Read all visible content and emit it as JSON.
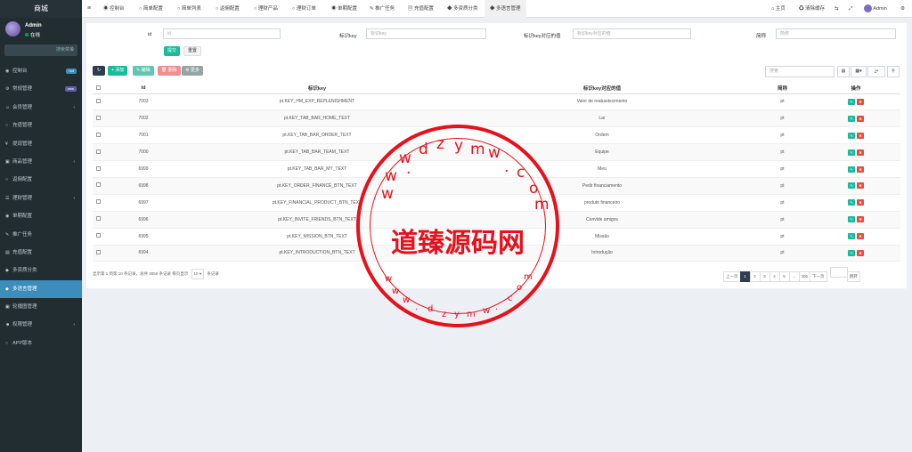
{
  "sidebar": {
    "logo": "商城",
    "user_name": "Admin",
    "user_status": "在线",
    "search_placeholder": "搜索菜单",
    "items": [
      {
        "label": "控制台",
        "badge": "hot"
      },
      {
        "label": "常规管理",
        "badge": "new"
      },
      {
        "label": "会员管理"
      },
      {
        "label": "充值管理"
      },
      {
        "label": "提现管理"
      },
      {
        "label": "商品管理"
      },
      {
        "label": "返佣配置"
      },
      {
        "label": "理财管理"
      },
      {
        "label": "单期配置"
      },
      {
        "label": "推广任务"
      },
      {
        "label": "充值配置"
      },
      {
        "label": "多资质分类"
      },
      {
        "label": "多语言管理"
      },
      {
        "label": "轮播图管理"
      },
      {
        "label": "权限管理"
      },
      {
        "label": "APP版本"
      }
    ]
  },
  "topbar": {
    "tabs": [
      "控制台",
      "简单配置",
      "简单列表",
      "返佣配置",
      "理财产品",
      "理财订单",
      "单期配置",
      "推广任务",
      "充值配置",
      "多资质分类",
      "多语言管理"
    ],
    "right": {
      "home": "主页",
      "clear": "清除缓存",
      "user": "Admin"
    }
  },
  "filter": {
    "id_label": "id",
    "id_placeholder": "id",
    "key_label": "标识key",
    "key_placeholder": "标识key",
    "val_label": "标识key对应的值",
    "val_placeholder": "标识key对应的值",
    "short_label": "简称",
    "short_placeholder": "简称",
    "submit": "提交",
    "reset": "重置"
  },
  "toolbar": {
    "add": "添加",
    "edit": "编辑",
    "del": "删除",
    "more": "更多",
    "search_placeholder": "搜索"
  },
  "table": {
    "headers": [
      "Id",
      "标识key",
      "标识key对应的值",
      "简称",
      "操作"
    ],
    "rows": [
      {
        "id": "7003",
        "key": "pt.KEY_HM_EXP_REPLENISHMENT",
        "val": "Valor de reabastecimento",
        "short": "pt"
      },
      {
        "id": "7002",
        "key": "pt.KEY_TAB_BAR_HOME_TEXT",
        "val": "Lar",
        "short": "pt"
      },
      {
        "id": "7001",
        "key": "pt.KEY_TAB_BAR_ORDER_TEXT",
        "val": "Ordem",
        "short": "pt"
      },
      {
        "id": "7000",
        "key": "pt.KEY_TAB_BAR_TEAM_TEXT",
        "val": "Equipe",
        "short": "pt"
      },
      {
        "id": "6999",
        "key": "pt.KEY_TAB_BAR_MY_TEXT",
        "val": "Meu",
        "short": "pt"
      },
      {
        "id": "6998",
        "key": "pt.KEY_ORDER_FINANCE_BTN_TEXT",
        "val": "Pedir financiamento",
        "short": "pt"
      },
      {
        "id": "6997",
        "key": "pt.KEY_FINANCIAL_PRODUCT_BTN_TEXT",
        "val": "produto financeiro",
        "short": "pt"
      },
      {
        "id": "6996",
        "key": "pt.KEY_INVITE_FRIENDS_BTN_TEXT",
        "val": "Convide amigos",
        "short": "pt"
      },
      {
        "id": "6995",
        "key": "pt.KEY_MISSION_BTN_TEXT",
        "val": "Missão",
        "short": "pt"
      },
      {
        "id": "6994",
        "key": "pt.KEY_INTRODUCTION_BTN_TEXT",
        "val": "Introdução",
        "short": "pt"
      }
    ]
  },
  "footer": {
    "summary": "显示第 1 到第 10 条记录，总共 3056 条记录 每页显示",
    "per_page": "10",
    "suffix": "条记录",
    "prev": "上一页",
    "pages": [
      "1",
      "2",
      "3",
      "4",
      "5",
      "...",
      "306"
    ],
    "next": "下一页",
    "jump": "跳转"
  },
  "watermark": {
    "text": "道臻源码网",
    "url_top": "www.dzymw.com",
    "url_bottom": "www.dzymw.com"
  }
}
